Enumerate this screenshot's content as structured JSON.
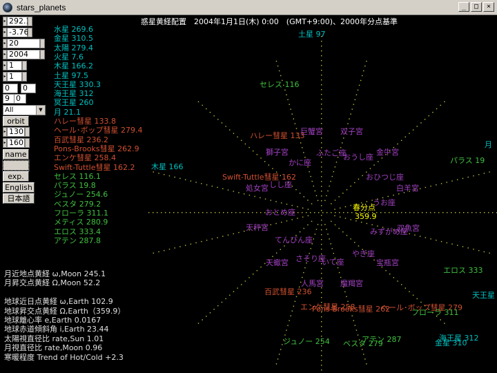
{
  "window": {
    "title": "stars_planets",
    "btn_min": "_",
    "btn_max": "□",
    "btn_close": "×"
  },
  "header": "惑星黄経配置　2004年1月1日(木) 0:00　(GMT+9:00)、2000年分点基準",
  "controls": {
    "spin_values": [
      "292.17",
      "-3.76",
      "20",
      "2004",
      "1",
      "1"
    ],
    "small_fields": [
      "0",
      "0",
      "9",
      "0"
    ],
    "select_value": "All",
    "btn_orbit": "orbit",
    "spin2_values": [
      "130",
      "160"
    ],
    "btn_name": "name",
    "btn_dotted": "",
    "btn_exp": "exp.",
    "btn_english": "English",
    "btn_japanese": "日本語"
  },
  "list": [
    {
      "text": "水星 269.6",
      "color": "#00c0c0"
    },
    {
      "text": "金星 310.5",
      "color": "#00c0c0"
    },
    {
      "text": "太陽 279.4",
      "color": "#00c0c0"
    },
    {
      "text": "火星 7.6",
      "color": "#00c0c0"
    },
    {
      "text": "木星 166.2",
      "color": "#00c0c0"
    },
    {
      "text": "土星 97.5",
      "color": "#00c0c0"
    },
    {
      "text": "天王星 330.3",
      "color": "#00c0c0"
    },
    {
      "text": "海王星 312",
      "color": "#00c0c0"
    },
    {
      "text": "冥王星 260",
      "color": "#00c0c0"
    },
    {
      "text": "月 21.1",
      "color": "#00c0c0"
    },
    {
      "text": "ハレー彗星 133.8",
      "color": "#d05030"
    },
    {
      "text": "ヘール･ボップ彗星 279.4",
      "color": "#d05030"
    },
    {
      "text": "百武彗星 236.2",
      "color": "#d05030"
    },
    {
      "text": "Pons-Brooks彗星 262.9",
      "color": "#d05030"
    },
    {
      "text": "エンケ彗星 258.4",
      "color": "#d05030"
    },
    {
      "text": "Swift-Tuttle彗星 162.2",
      "color": "#d05030"
    },
    {
      "text": "セレス 116.1",
      "color": "#40c040"
    },
    {
      "text": "パラス 19.8",
      "color": "#40c040"
    },
    {
      "text": "ジュノー 254.6",
      "color": "#40c040"
    },
    {
      "text": "ベスタ 279.2",
      "color": "#40c040"
    },
    {
      "text": "フローラ 311.1",
      "color": "#40c040"
    },
    {
      "text": "メティス 280.9",
      "color": "#40c040"
    },
    {
      "text": "エロス 333.4",
      "color": "#40c040"
    },
    {
      "text": "アテン 287.8",
      "color": "#40c040"
    }
  ],
  "jupiter_side": "木星 166",
  "info": [
    "月近地点黄経 ω,Moon 245.1",
    "月昇交点黄経 Ω,Moon 52.2",
    "",
    "地球近日点黄経 ω,Earth 102.9",
    "地球昇交点黄経 Ω,Earth（359.9）",
    "地球離心率 e,Earth 0.0167",
    "地球赤道傾斜角 i,Earth 23.44",
    "太陽視直径比 rate,Sun 1.01",
    "月視直径比 rate,Moon 0.96",
    "寒暖程度 Trend of Hot/Cold +2.3"
  ],
  "sky_labels": [
    {
      "text": "土星 97",
      "color": "#00c0c0"
    },
    {
      "text": "セレス 116",
      "color": "#40c040"
    },
    {
      "text": "ハレー彗星 133",
      "color": "#d05030"
    },
    {
      "text": "巨蟹宮",
      "color": "#a040c0"
    },
    {
      "text": "双子宮",
      "color": "#a040c0"
    },
    {
      "text": "獅子宮",
      "color": "#a040c0"
    },
    {
      "text": "ふたご座",
      "color": "#a040c0"
    },
    {
      "text": "金牛宮",
      "color": "#a040c0"
    },
    {
      "text": "かに座",
      "color": "#a040c0"
    },
    {
      "text": "おうし座",
      "color": "#a040c0"
    },
    {
      "text": "月",
      "color": "#00c0c0"
    },
    {
      "text": "パラス 19",
      "color": "#40c040"
    },
    {
      "text": "Swift-Tuttle彗星 162",
      "color": "#d05030"
    },
    {
      "text": "処女宮",
      "color": "#a040c0"
    },
    {
      "text": "しし座",
      "color": "#a040c0"
    },
    {
      "text": "おひつじ座",
      "color": "#a040c0"
    },
    {
      "text": "白羊宮",
      "color": "#a040c0"
    },
    {
      "text": "うお座",
      "color": "#a040c0"
    },
    {
      "text": "春分点",
      "color": "#ffff00"
    },
    {
      "text": "359.9",
      "color": "#ffff00"
    },
    {
      "text": "おとめ座",
      "color": "#a040c0"
    },
    {
      "text": "天秤宮",
      "color": "#a040c0"
    },
    {
      "text": "双魚宮",
      "color": "#a040c0"
    },
    {
      "text": "みずがめ座",
      "color": "#a040c0"
    },
    {
      "text": "てんびん座",
      "color": "#a040c0"
    },
    {
      "text": "やぎ座",
      "color": "#a040c0"
    },
    {
      "text": "さそり座",
      "color": "#a040c0"
    },
    {
      "text": "いて座",
      "color": "#a040c0"
    },
    {
      "text": "天蠍宮",
      "color": "#a040c0"
    },
    {
      "text": "宝瓶宮",
      "color": "#a040c0"
    },
    {
      "text": "エロス 333",
      "color": "#40c040"
    },
    {
      "text": "人馬宮",
      "color": "#a040c0"
    },
    {
      "text": "魔羯宮",
      "color": "#a040c0"
    },
    {
      "text": "天王星",
      "color": "#00c0c0"
    },
    {
      "text": "百武彗星 236",
      "color": "#d05030"
    },
    {
      "text": "エンケ彗星 258",
      "color": "#d05030"
    },
    {
      "text": "ヘール･ボップ彗星 279",
      "color": "#d05030"
    },
    {
      "text": "Pons-Brooks彗星 262",
      "color": "#d05030"
    },
    {
      "text": "フローラ 311",
      "color": "#40c040"
    },
    {
      "text": "ジュノー 254",
      "color": "#40c040"
    },
    {
      "text": "アテン 287",
      "color": "#40c040"
    },
    {
      "text": "ベスタ 279",
      "color": "#40c040"
    },
    {
      "text": "海王星 312",
      "color": "#00c0c0"
    },
    {
      "text": "金星 310",
      "color": "#00c0c0"
    }
  ]
}
